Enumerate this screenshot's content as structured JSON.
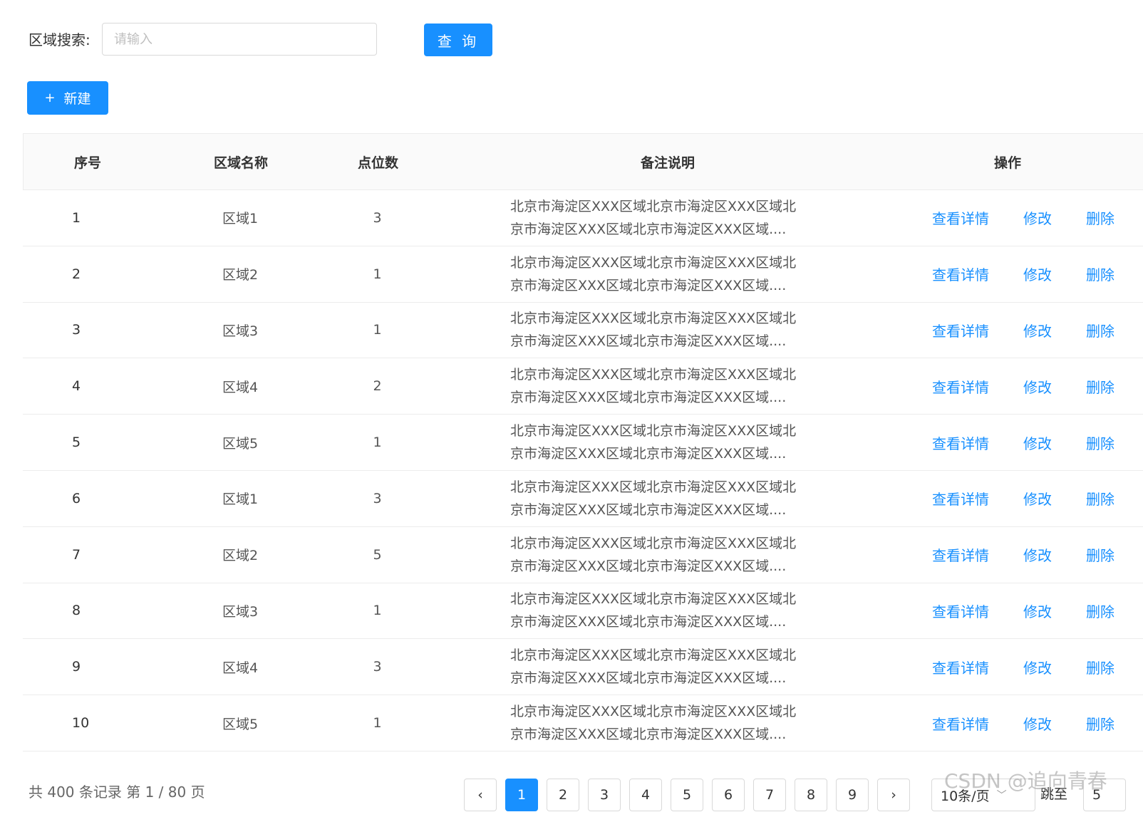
{
  "search": {
    "label": "区域搜索:",
    "placeholder": "请输入",
    "query_button": "查 询"
  },
  "toolbar": {
    "new_icon": "+",
    "new_label": "新建"
  },
  "table": {
    "headers": {
      "index": "序号",
      "name": "区域名称",
      "count": "点位数",
      "note": "备注说明",
      "ops": "操作"
    },
    "ops_labels": {
      "detail": "查看详情",
      "edit": "修改",
      "delete": "删除"
    },
    "rows": [
      {
        "index": "1",
        "name": "区域1",
        "count": "3",
        "note_line1": "北京市海淀区XXX区域北京市海淀区XXX区域北",
        "note_line2": "京市海淀区XXX区域北京市海淀区XXX区域...."
      },
      {
        "index": "2",
        "name": "区域2",
        "count": "1",
        "note_line1": "北京市海淀区XXX区域北京市海淀区XXX区域北",
        "note_line2": "京市海淀区XXX区域北京市海淀区XXX区域...."
      },
      {
        "index": "3",
        "name": "区域3",
        "count": "1",
        "note_line1": "北京市海淀区XXX区域北京市海淀区XXX区域北",
        "note_line2": "京市海淀区XXX区域北京市海淀区XXX区域...."
      },
      {
        "index": "4",
        "name": "区域4",
        "count": "2",
        "note_line1": "北京市海淀区XXX区域北京市海淀区XXX区域北",
        "note_line2": "京市海淀区XXX区域北京市海淀区XXX区域...."
      },
      {
        "index": "5",
        "name": "区域5",
        "count": "1",
        "note_line1": "北京市海淀区XXX区域北京市海淀区XXX区域北",
        "note_line2": "京市海淀区XXX区域北京市海淀区XXX区域...."
      },
      {
        "index": "6",
        "name": "区域1",
        "count": "3",
        "note_line1": "北京市海淀区XXX区域北京市海淀区XXX区域北",
        "note_line2": "京市海淀区XXX区域北京市海淀区XXX区域...."
      },
      {
        "index": "7",
        "name": "区域2",
        "count": "5",
        "note_line1": "北京市海淀区XXX区域北京市海淀区XXX区域北",
        "note_line2": "京市海淀区XXX区域北京市海淀区XXX区域...."
      },
      {
        "index": "8",
        "name": "区域3",
        "count": "1",
        "note_line1": "北京市海淀区XXX区域北京市海淀区XXX区域北",
        "note_line2": "京市海淀区XXX区域北京市海淀区XXX区域...."
      },
      {
        "index": "9",
        "name": "区域4",
        "count": "3",
        "note_line1": "北京市海淀区XXX区域北京市海淀区XXX区域北",
        "note_line2": "京市海淀区XXX区域北京市海淀区XXX区域...."
      },
      {
        "index": "10",
        "name": "区域5",
        "count": "1",
        "note_line1": "北京市海淀区XXX区域北京市海淀区XXX区域北",
        "note_line2": "京市海淀区XXX区域北京市海淀区XXX区域...."
      }
    ]
  },
  "pagination": {
    "summary": "共 400 条记录 第 1 / 80 页",
    "prev_icon": "‹",
    "next_icon": "›",
    "pages": [
      "1",
      "2",
      "3",
      "4",
      "5",
      "6",
      "7",
      "8",
      "9"
    ],
    "current_page": "1",
    "page_size": "10条/页",
    "jump_label": "跳至",
    "jump_value": "5"
  },
  "watermark": "CSDN @追向青春",
  "colors": {
    "primary": "#1890ff",
    "header_bg": "#fafafa",
    "border": "#ececec"
  }
}
